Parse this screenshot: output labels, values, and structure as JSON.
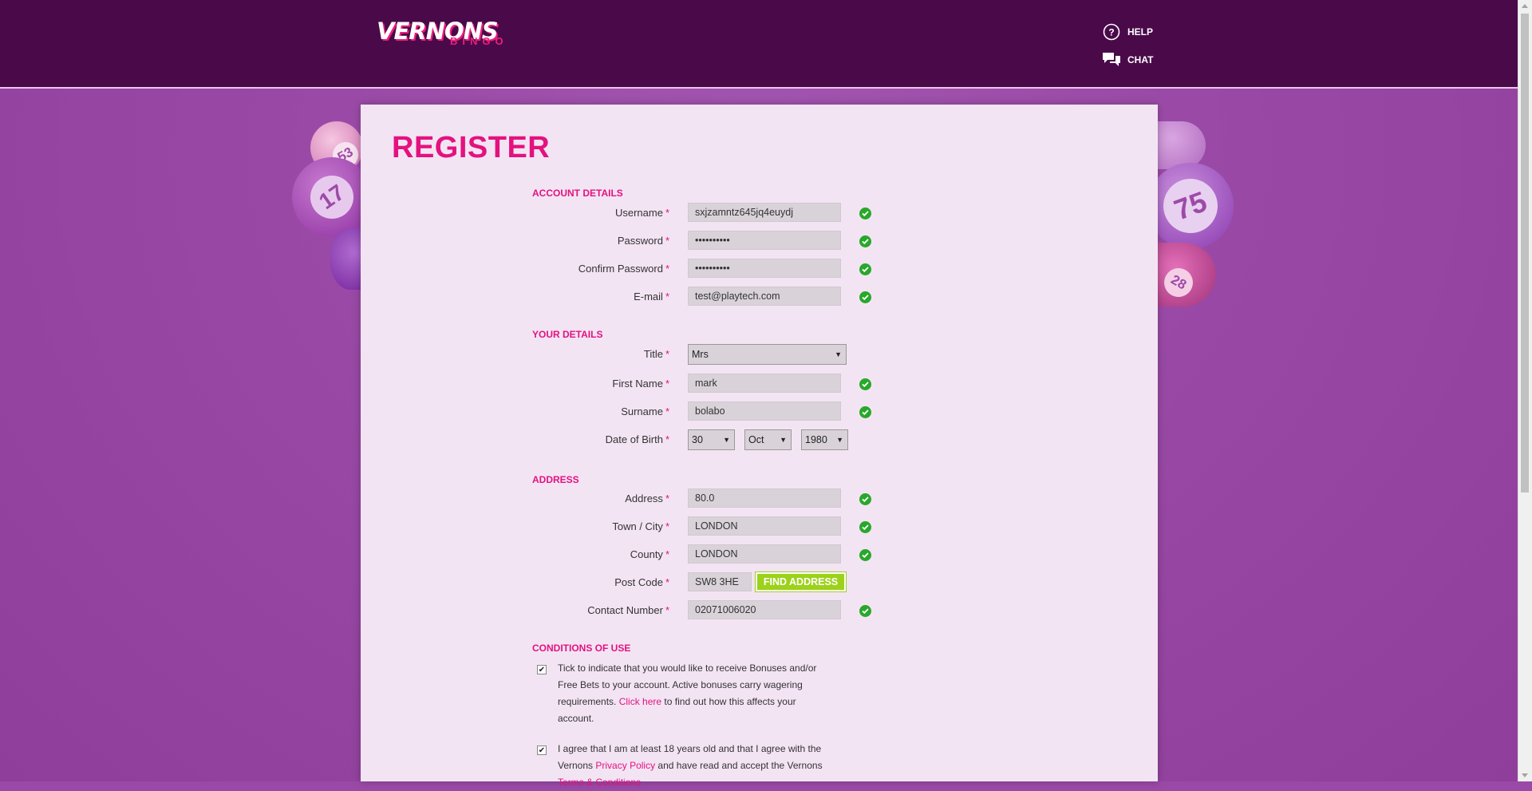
{
  "header": {
    "logo_main": "VERNONS",
    "logo_sub": "BINGO",
    "help_label": "HELP",
    "chat_label": "CHAT"
  },
  "balls": [
    "53",
    "17",
    "75",
    "28"
  ],
  "page": {
    "title": "REGISTER"
  },
  "sections": {
    "account": "ACCOUNT DETAILS",
    "details": "YOUR DETAILS",
    "address": "ADDRESS",
    "conditions": "CONDITIONS OF USE"
  },
  "account": {
    "username_label": "Username",
    "username_value": "sxjzamntz645jq4euydj",
    "password_label": "Password",
    "password_value": "••••••••••",
    "confirm_label": "Confirm Password",
    "confirm_value": "••••••••••",
    "email_label": "E-mail",
    "email_value": "test@playtech.com"
  },
  "details": {
    "title_label": "Title",
    "title_value": "Mrs",
    "first_label": "First Name",
    "first_value": "mark",
    "surname_label": "Surname",
    "surname_value": "bolabo",
    "dob_label": "Date of Birth",
    "dob_day": "30",
    "dob_month": "Oct",
    "dob_year": "1980"
  },
  "address": {
    "address_label": "Address",
    "address_value": "80.0",
    "town_label": "Town / City",
    "town_value": "LONDON",
    "county_label": "County",
    "county_value": "LONDON",
    "postcode_label": "Post Code",
    "postcode_value": "SW8 3HE",
    "find_button": "FIND ADDRESS",
    "contact_label": "Contact Number",
    "contact_value": "02071006020"
  },
  "required_mark": "*",
  "conditions": {
    "bonus_text_1": "Tick to indicate that you would like to receive Bonuses and/or Free Bets to your account. Active bonuses carry wagering requirements.",
    "bonus_link": "Click here",
    "bonus_text_2": "to find out how this affects your account.",
    "age_text_1": "I agree that I am at least 18 years old and that I agree with the Vernons",
    "privacy_link": "Privacy Policy",
    "age_text_2": "and have read and accept the Vernons",
    "terms_link": "Terms & Conditions"
  },
  "colors": {
    "header_bg": "#4a0a4a",
    "page_bg": "#9a4aa6",
    "accent_pink": "#e3127f",
    "valid_green": "#28a82a",
    "button_green": "#9cd11c"
  }
}
